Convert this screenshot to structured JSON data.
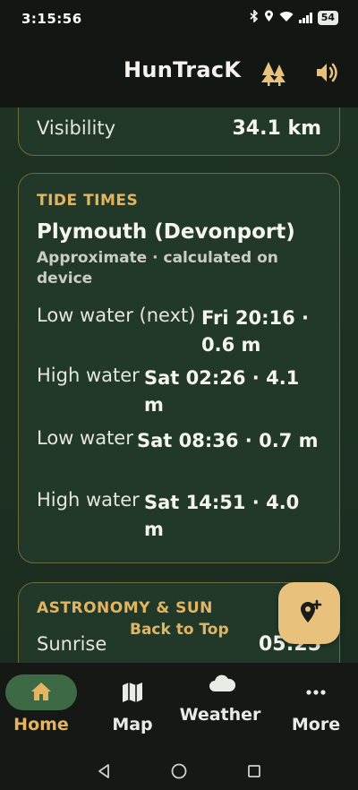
{
  "status_bar": {
    "time": "3:15:56",
    "battery": "54",
    "icons": [
      "bluetooth-icon",
      "location-icon",
      "wifi-icon",
      "signal-icon",
      "battery-icon"
    ]
  },
  "app_bar": {
    "title": "HunTracK",
    "icons": [
      "trees-icon",
      "sound-icon"
    ]
  },
  "visibility": {
    "label": "Visibility",
    "value": "34.1 km"
  },
  "tides": {
    "heading": "TIDE TIMES",
    "station": "Plymouth (Devonport)",
    "note": "Approximate · calculated on device",
    "rows": [
      {
        "label": "Low water (next)",
        "value": "Fri 20:16 · 0.6 m"
      },
      {
        "label": "High water",
        "value": "Sat 02:26 · 4.1 m"
      },
      {
        "label": "Low water",
        "value": "Sat 08:36 · 0.7 m"
      },
      {
        "label": "High water",
        "value": "Sat 14:51 · 4.0 m"
      }
    ]
  },
  "astronomy": {
    "heading": "ASTRONOMY & SUN",
    "sunrise_label": "Sunrise",
    "sunrise_value": "05:25"
  },
  "back_to_top": "Back to Top",
  "fab_icon": "add-location-icon",
  "bottom_nav": {
    "items": [
      {
        "label": "Home",
        "icon": "home-icon",
        "active": true
      },
      {
        "label": "Map",
        "icon": "map-icon",
        "active": false
      },
      {
        "label": "Weather",
        "icon": "cloud-icon",
        "active": false
      },
      {
        "label": "More",
        "icon": "more-icon",
        "active": false
      }
    ]
  },
  "colors": {
    "accent": "#e3b561",
    "card_border": "#6c6a3f",
    "card_bg": "#22392a",
    "nav_active_pill": "#3d6a44"
  }
}
